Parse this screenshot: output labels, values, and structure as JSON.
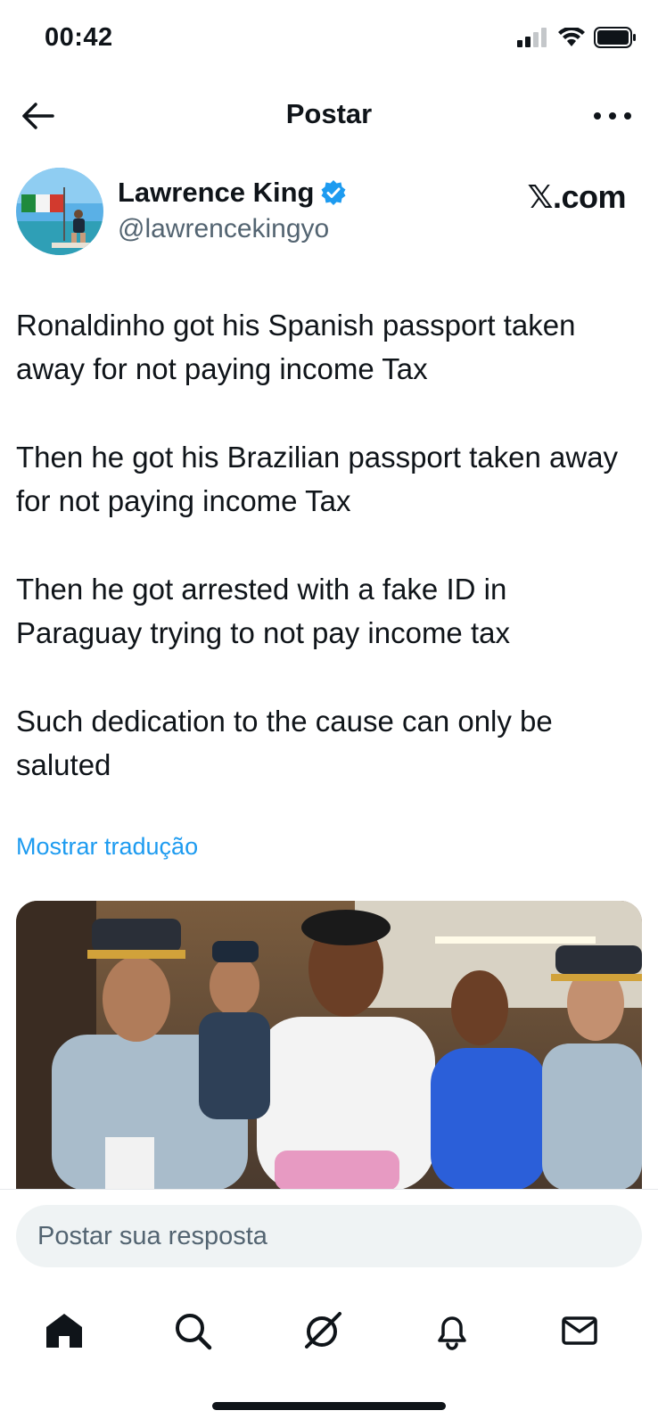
{
  "status_bar": {
    "time": "00:42"
  },
  "nav": {
    "title": "Postar"
  },
  "author": {
    "name": "Lawrence King",
    "handle": "@lawrencekingyo",
    "verified": true,
    "source": "𝕏.com"
  },
  "tweet": {
    "paragraphs": [
      "Ronaldinho got his Spanish passport taken away for not paying income Tax",
      "Then he got his Brazilian passport taken away for not paying income Tax",
      "Then he got arrested with a fake ID in Paraguay trying to not pay income tax",
      "Such dedication to the cause can only be saluted"
    ],
    "translate_label": "Mostrar tradução"
  },
  "reply": {
    "placeholder": "Postar sua resposta"
  },
  "tabs": [
    {
      "name": "home-icon"
    },
    {
      "name": "search-icon"
    },
    {
      "name": "grok-icon"
    },
    {
      "name": "bell-icon"
    },
    {
      "name": "mail-icon"
    }
  ],
  "colors": {
    "accent": "#1d9bf0",
    "text": "#0f1419",
    "muted": "#536471"
  }
}
